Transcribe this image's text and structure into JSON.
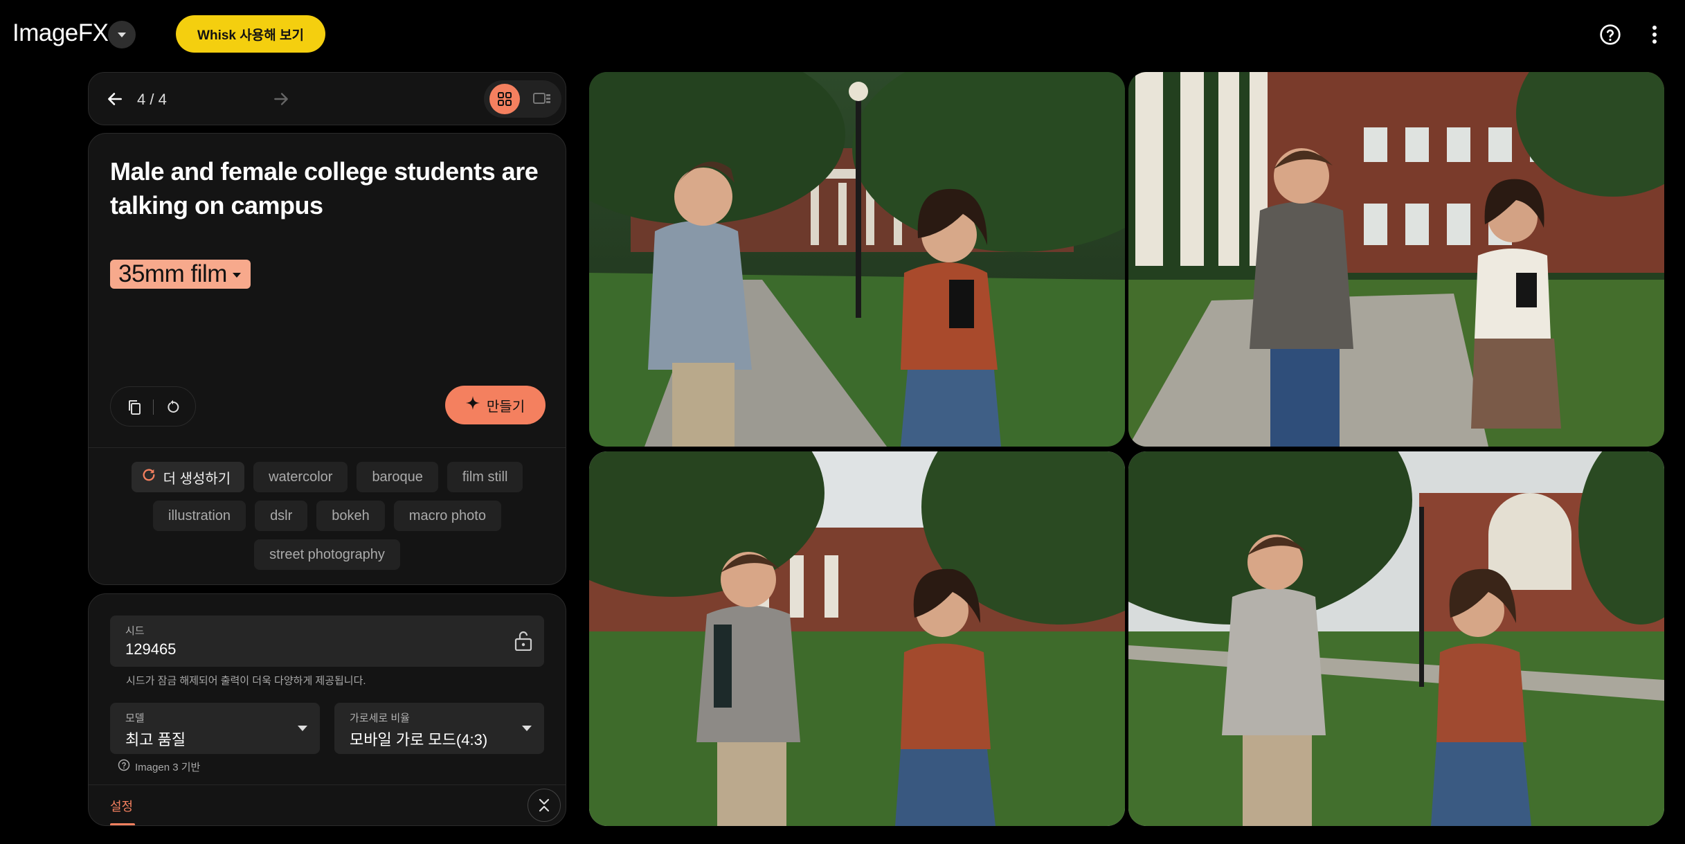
{
  "header": {
    "logo": "ImageFX",
    "whisk_label": "Whisk 사용해 보기"
  },
  "nav": {
    "counter": "4 / 4"
  },
  "prompt": {
    "text": "Male and female college students are talking on campus",
    "style_chip": "35mm film",
    "create_label": "만들기"
  },
  "suggestions": {
    "more_label": "더 생성하기",
    "row1": [
      "watercolor",
      "baroque",
      "film still"
    ],
    "row2": [
      "illustration",
      "dslr",
      "bokeh",
      "macro photo"
    ],
    "row3": [
      "street photography"
    ]
  },
  "settings": {
    "seed_label": "시드",
    "seed_value": "129465",
    "seed_hint": "시드가 잠금 해제되어 출력이 더욱 다양하게 제공됩니다.",
    "model_label": "모델",
    "model_value": "최고 품질",
    "ratio_label": "가로세로 비율",
    "ratio_value": "모바일 가로 모드(4:3)",
    "imagen_note": "Imagen 3 기반",
    "tab_label": "설정"
  },
  "colors": {
    "accent": "#f4805f",
    "whisk": "#f4cf0f",
    "chip_style": "#f7a98c"
  },
  "icons": {
    "logo_dropdown": "chevron-down-icon",
    "help": "help-circle-icon",
    "more": "more-vert-icon",
    "back": "arrow-left-icon",
    "forward": "arrow-right-icon",
    "grid": "grid-view-icon",
    "single": "single-view-icon",
    "copy": "copy-icon",
    "reset": "reset-icon",
    "sparkle": "sparkle-icon",
    "refresh": "refresh-icon",
    "lock": "unlock-icon",
    "collapse": "collapse-icon"
  }
}
